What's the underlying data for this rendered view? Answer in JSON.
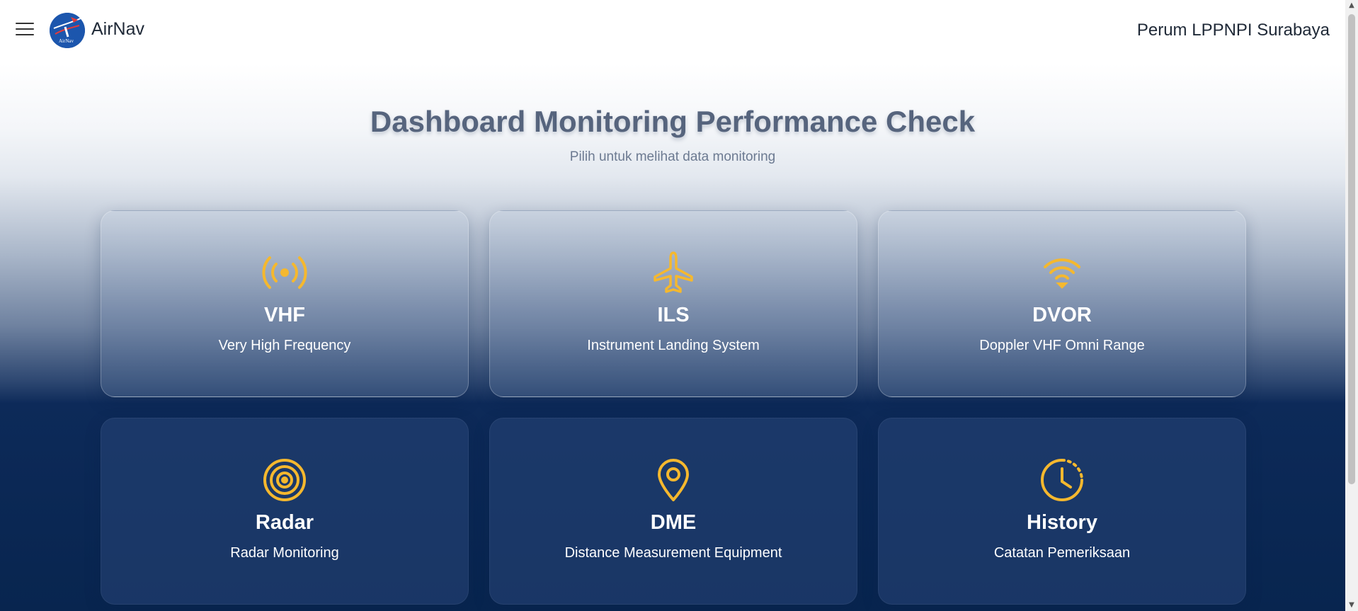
{
  "header": {
    "brand": "AirNav",
    "organization": "Perum LPPNPI Surabaya"
  },
  "main": {
    "title": "Dashboard Monitoring Performance Check",
    "subtitle": "Pilih untuk melihat data monitoring"
  },
  "cards": [
    {
      "title": "VHF",
      "description": "Very High Frequency",
      "icon": "broadcast-icon"
    },
    {
      "title": "ILS",
      "description": "Instrument Landing System",
      "icon": "airplane-icon"
    },
    {
      "title": "DVOR",
      "description": "Doppler VHF Omni Range",
      "icon": "wifi-icon"
    },
    {
      "title": "Radar",
      "description": "Radar Monitoring",
      "icon": "radar-icon"
    },
    {
      "title": "DME",
      "description": "Distance Measurement Equipment",
      "icon": "location-pin-icon"
    },
    {
      "title": "History",
      "description": "Catatan Pemeriksaan",
      "icon": "clock-history-icon"
    }
  ],
  "colors": {
    "accent": "#f5b82e",
    "navy": "#08254f",
    "text_dark": "#1f2937"
  }
}
